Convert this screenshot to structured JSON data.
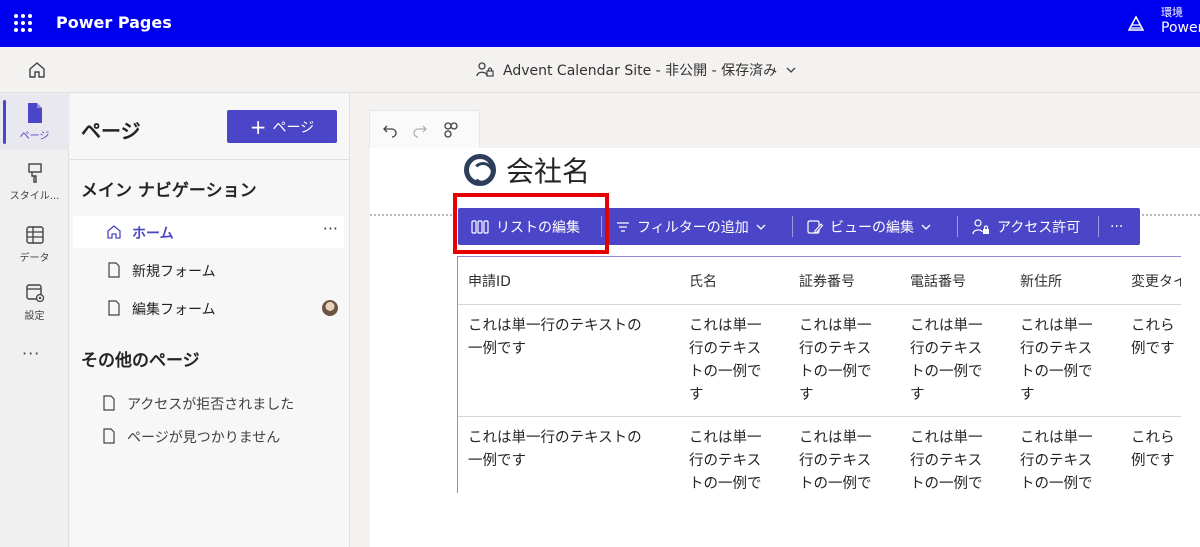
{
  "topbar": {
    "app_title": "Power Pages",
    "env_label": "環境",
    "env_name": "Power"
  },
  "cmdbar": {
    "site_status": "Advent Calendar Site - 非公開 - 保存済み"
  },
  "rail": {
    "items": [
      {
        "label": "ページ"
      },
      {
        "label": "スタイル..."
      },
      {
        "label": "データ"
      },
      {
        "label": "設定"
      }
    ],
    "more": "···"
  },
  "panel": {
    "title": "ページ",
    "add_button": "ページ",
    "main_nav_heading": "メイン ナビゲーション",
    "main_nav": [
      {
        "label": "ホーム"
      },
      {
        "label": "新規フォーム"
      },
      {
        "label": "編集フォーム"
      }
    ],
    "other_heading": "その他のページ",
    "other_pages": [
      {
        "label": "アクセスが拒否されました"
      },
      {
        "label": "ページが見つかりません"
      }
    ]
  },
  "site": {
    "company_name": "会社名"
  },
  "list_toolbar": {
    "edit_list": "リストの編集",
    "add_filter": "フィルターの追加",
    "edit_view": "ビューの編集",
    "permissions": "アクセス許可",
    "more": "···"
  },
  "table": {
    "columns": [
      "申請ID",
      "氏名",
      "証券番号",
      "電話番号",
      "新住所",
      "変更タイ"
    ],
    "rows": [
      {
        "cells": [
          "これは単一行のテキストの\n一例です",
          "これは単一\n行のテキス\nトの一例で\nす",
          "これは単一\n行のテキス\nトの一例で\nす",
          "これは単一\n行のテキス\nトの一例で\nす",
          "これは単一\n行のテキス\nトの一例で\nす",
          "これら\n例です"
        ]
      },
      {
        "cells": [
          "これは単一行のテキストの\n一例です",
          "これは単一\n行のテキス\nトの一例で\nす",
          "これは単一\n行のテキス\nトの一例で\nす",
          "これは単一\n行のテキス\nトの一例で\nす",
          "これは単一\n行のテキス\nトの一例で\nす",
          "これら\n例です"
        ]
      }
    ]
  },
  "colors": {
    "brand": "#0000f0",
    "accent": "#4b45c8",
    "highlight": "#e60000"
  }
}
